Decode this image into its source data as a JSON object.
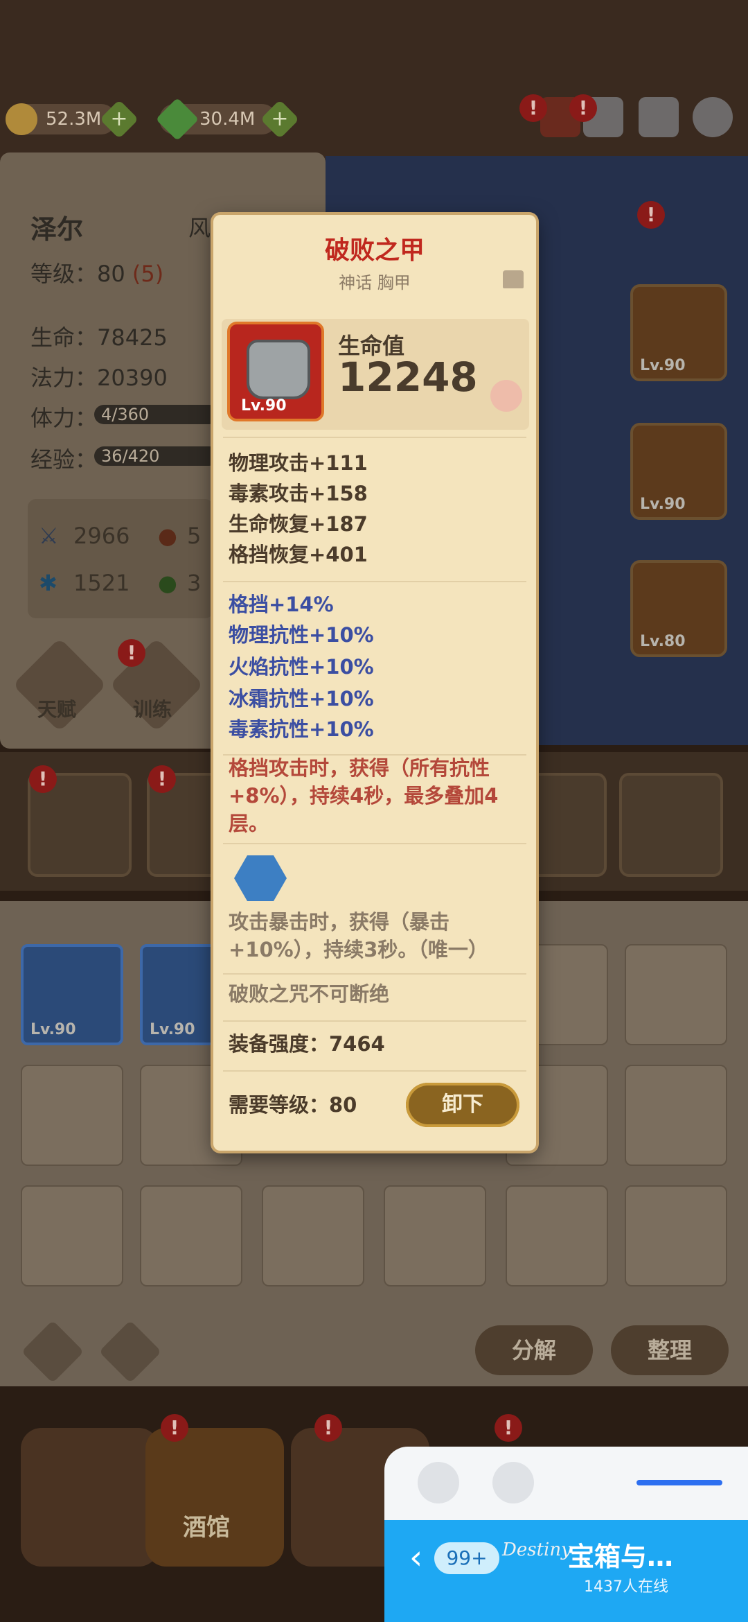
{
  "resources": {
    "gold": "52.3M",
    "gems": "30.4M",
    "plus": "+"
  },
  "alert_mark": "!",
  "hero": {
    "name": "泽尔",
    "class_partial": "风",
    "level_label": "等级：",
    "level": "80",
    "level_extra": "(5)",
    "hp_label": "生命：",
    "hp": "78425",
    "mana_label": "法力：",
    "mana": "20390",
    "stamina_label": "体力：",
    "stamina": "4/360",
    "exp_label": "经验：",
    "exp": "36/420",
    "atk": "2966",
    "frost": "1521",
    "fire_partial": "5",
    "poison_partial": "3"
  },
  "hero_buttons": {
    "talent": "天赋",
    "train": "训练"
  },
  "scene_slots": {
    "lv_a": "Lv.90",
    "lv_b": "Lv.90",
    "lv_c": "Lv.80"
  },
  "inventory": {
    "slot1_lv": "Lv.90",
    "slot2_lv": "Lv.90",
    "decompose": "分解",
    "sort": "整理"
  },
  "nav": {
    "tavern": "酒馆"
  },
  "tooltip": {
    "title": "破败之甲",
    "subtitle": "神话 胸甲",
    "item_level": "Lv.90",
    "main_stat_label": "生命值",
    "main_stat_value": "12248",
    "base_stats": [
      "物理攻击+111",
      "毒素攻击+158",
      "生命恢复+187",
      "格挡恢复+401"
    ],
    "bonus_stats": [
      "格挡+14%",
      "物理抗性+10%",
      "火焰抗性+10%",
      "冰霜抗性+10%",
      "毒素抗性+10%"
    ],
    "effect_text": "格挡攻击时，获得（所有抗性+8%），持续4秒，最多叠加4层。",
    "gem_effect": "攻击暴击时，获得（暴击+10%），持续3秒。（唯一）",
    "curse_text": "破败之咒不可断绝",
    "power_text": "装备强度：7464",
    "required_text": "需要等级：80",
    "unequip_label": "卸下"
  },
  "widget": {
    "badge": "99+",
    "logo": "Destiny",
    "title": "宝箱与…",
    "online": "1437人在线",
    "back": "‹"
  },
  "colors": {
    "title_red": "#c0281e",
    "bonus_blue": "#3b4ea2",
    "effect_red": "#b4483a",
    "gem_blue": "#3d7fc3",
    "widget_blue": "#1ea8f3"
  }
}
